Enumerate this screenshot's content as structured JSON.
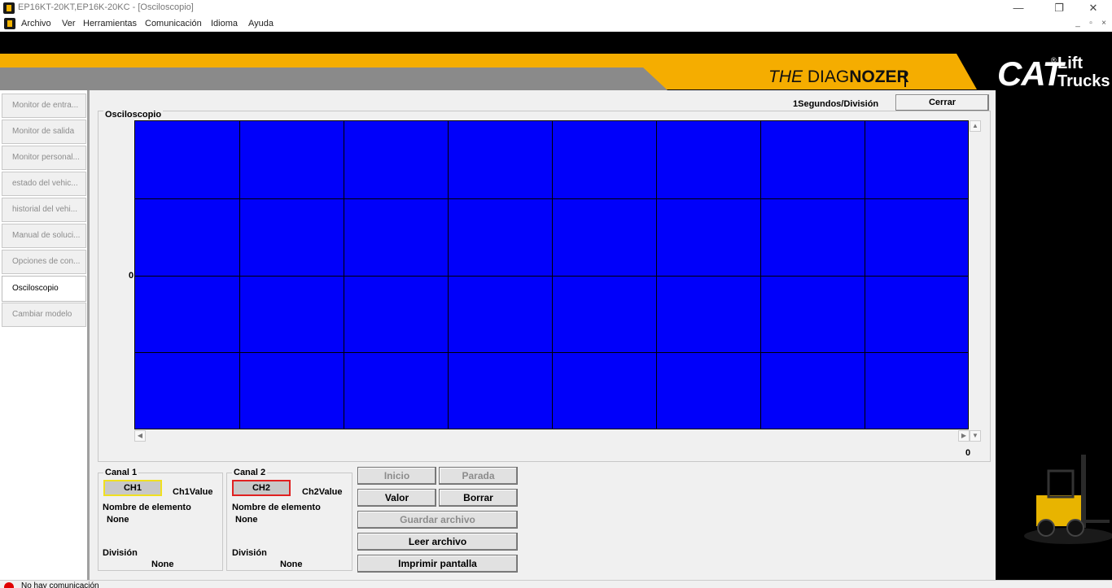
{
  "window": {
    "title": "EP16KT-20KT,EP16K-20KC - [Osciloscopio]",
    "minimize": "—",
    "maximize": "❐",
    "close": "✕"
  },
  "menu": {
    "items": [
      "Archivo",
      "Ver",
      "Herramientas",
      "Comunicación",
      "Idioma",
      "Ayuda"
    ],
    "mdi_min": "_",
    "mdi_restore": "▫",
    "mdi_close": "×"
  },
  "header": {
    "brand_the": "THE ",
    "brand_diag": "DIAG",
    "brand_nozer": "NOZER",
    "logo_cat": "CAT",
    "logo_reg": "®",
    "logo_lift": "Lift",
    "logo_trucks": "Trucks"
  },
  "sidebar": {
    "items": [
      {
        "label": "Monitor de entra..."
      },
      {
        "label": "Monitor de salida"
      },
      {
        "label": "Monitor personal..."
      },
      {
        "label": "estado del vehic..."
      },
      {
        "label": "historial del vehi..."
      },
      {
        "label": "Manual de soluci..."
      },
      {
        "label": "Opciones de con..."
      },
      {
        "label": "Osciloscopio",
        "active": true
      },
      {
        "label": "Cambiar modelo"
      }
    ]
  },
  "scope": {
    "time_division": "1Segundos/División",
    "close_button": "Cerrar",
    "frame_title": "Osciloscopio",
    "y_zero_label": "0",
    "x_end_label": "0",
    "background_color": "#0000fa",
    "grid_columns": 8,
    "grid_rows": 4
  },
  "channel1": {
    "group_title": "Canal 1",
    "button": "CH1",
    "value": "Ch1Value",
    "element_label": "Nombre de elemento",
    "element_value": "None",
    "division_label": "División",
    "division_value": "None",
    "border_color": "#f0e020"
  },
  "channel2": {
    "group_title": "Canal 2",
    "button": "CH2",
    "value": "Ch2Value",
    "element_label": "Nombre de elemento",
    "element_value": "None",
    "division_label": "División",
    "division_value": "None",
    "border_color": "#e02020"
  },
  "controls": {
    "inicio": "Inicio",
    "parada": "Parada",
    "valor": "Valor",
    "borrar": "Borrar",
    "guardar": "Guardar archivo",
    "leer": "Leer archivo",
    "imprimir": "Imprimir pantalla"
  },
  "status": {
    "text": "No hay comunicación"
  }
}
